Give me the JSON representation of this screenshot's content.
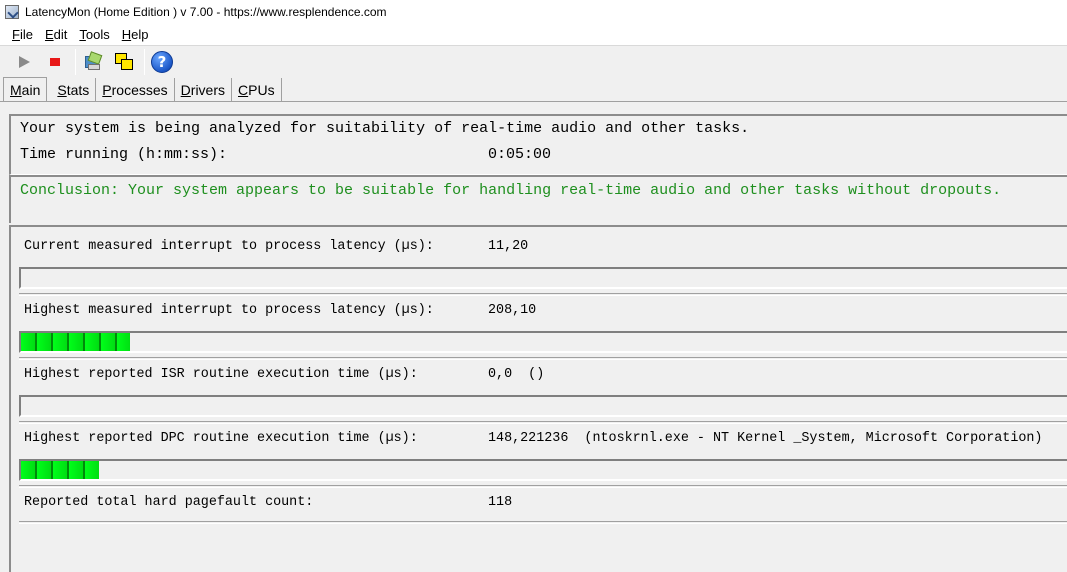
{
  "window": {
    "title": "LatencyMon  (Home Edition )  v 7.00 - https://www.resplendence.com"
  },
  "menu": {
    "items": [
      {
        "label_first": "F",
        "label_rest": "ile"
      },
      {
        "label_first": "E",
        "label_rest": "dit"
      },
      {
        "label_first": "T",
        "label_rest": "ools"
      },
      {
        "label_first": "H",
        "label_rest": "elp"
      }
    ]
  },
  "toolbar": {
    "buttons": [
      "play-icon",
      "stop-icon",
      "drivers-icon",
      "windows-icon",
      "help-icon"
    ],
    "help_glyph": "?"
  },
  "tabs": [
    {
      "first": "M",
      "rest": "ain",
      "active": true
    },
    {
      "first": "S",
      "rest": "tats",
      "active": false
    },
    {
      "first": "P",
      "rest": "rocesses",
      "active": false
    },
    {
      "first": "D",
      "rest": "rivers",
      "active": false
    },
    {
      "first": "C",
      "rest": "PUs",
      "active": false
    }
  ],
  "analysis": {
    "status_line": "Your system is being analyzed for suitability of real-time audio and other tasks.",
    "time_label": "Time running (h:mm:ss):",
    "time_value": "0:05:00"
  },
  "conclusion": {
    "text": "Conclusion: Your system appears to be suitable for handling real-time audio and other tasks without dropouts.",
    "color": "#1e8f1e"
  },
  "metrics": [
    {
      "label": "Current measured interrupt to process latency (µs):",
      "value": "11,20",
      "bar_fraction": 0.0
    },
    {
      "label": "Highest measured interrupt to process latency (µs):",
      "value": "208,10",
      "bar_fraction": 0.104
    },
    {
      "label": "Highest reported ISR routine execution time (µs):",
      "value": "0,0  ()",
      "bar_fraction": 0.0
    },
    {
      "label": "Highest reported DPC routine execution time (µs):",
      "value": "148,221236  (ntoskrnl.exe - NT Kernel _System, Microsoft Corporation)",
      "bar_fraction": 0.074
    },
    {
      "label": "Reported total hard pagefault count:",
      "value": "118"
    }
  ],
  "colors": {
    "bar_green": "#00ff1a",
    "stop_red": "#e81818"
  }
}
